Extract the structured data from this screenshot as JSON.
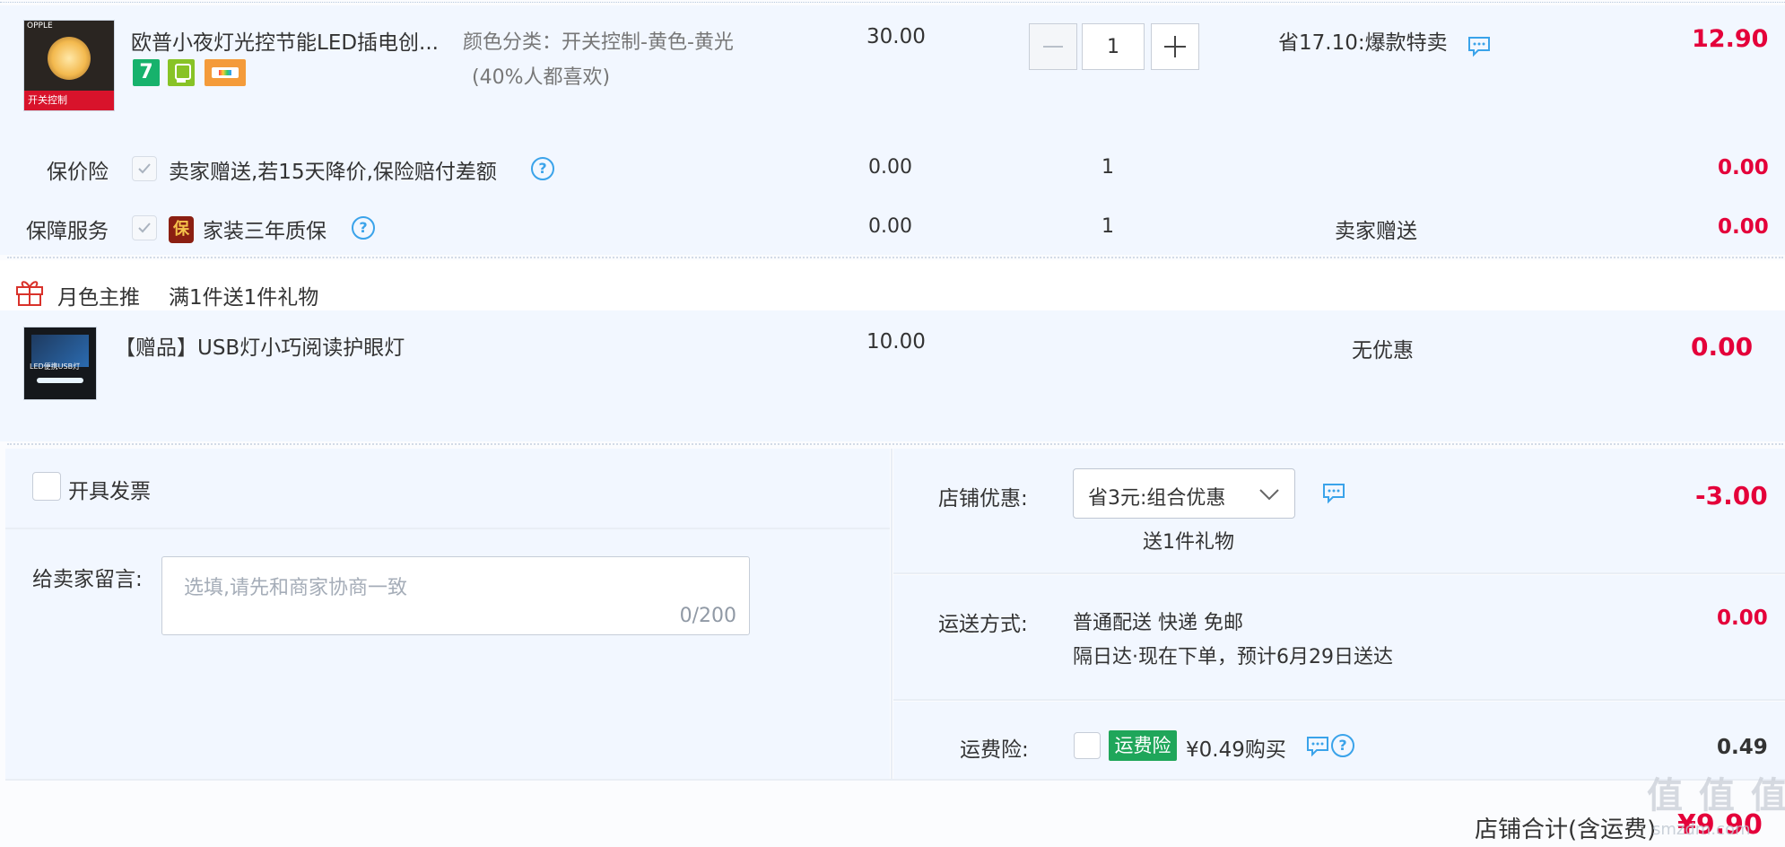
{
  "product": {
    "title": "欧普小夜灯光控节能LED插电创...",
    "sku_prefix": "颜色分类：",
    "sku_value": "开关控制-黄色-黄光",
    "popularity": "(40%人都喜欢)",
    "unit_price": "30.00",
    "quantity": "1",
    "promo": "省17.10:爆款特卖",
    "subtotal": "12.90",
    "tag1_text": "7",
    "thumb_brand": "OPPLE",
    "thumb_caption": "开关控制"
  },
  "services": [
    {
      "label": "保价险",
      "desc": "卖家赠送,若15天降价,保险赔付差额",
      "price": "0.00",
      "qty": "1",
      "promo": "",
      "subtotal": "0.00"
    },
    {
      "label": "保障服务",
      "badge": "保",
      "desc": "家装三年质保",
      "price": "0.00",
      "qty": "1",
      "promo": "卖家赠送",
      "subtotal": "0.00"
    }
  ],
  "gift_section": {
    "store_name": "月色主推",
    "rule": "满1件送1件礼物"
  },
  "gift_item": {
    "title": "【赠品】USB灯小巧阅读护眼灯",
    "price": "10.00",
    "promo": "无优惠",
    "subtotal": "0.00",
    "thumb_caption": "LED便携USB灯"
  },
  "invoice": {
    "label": "开具发票"
  },
  "message": {
    "label": "给卖家留言:",
    "placeholder": "选填,请先和商家协商一致",
    "counter": "0/200"
  },
  "store_discount": {
    "label": "店铺优惠:",
    "selected": "省3元:组合优惠",
    "note": "送1件礼物",
    "amount": "-3.00"
  },
  "shipping": {
    "label": "运送方式:",
    "method": "普通配送 快递 免邮",
    "eta": "隔日达·现在下单，预计6月29日送达",
    "amount": "0.00"
  },
  "freight_insurance": {
    "label": "运费险:",
    "badge": "运费险",
    "desc": "¥0.49购买",
    "amount": "0.49"
  },
  "total": {
    "label": "店铺合计(含运费)",
    "amount": "¥9.90"
  },
  "watermark": {
    "text": "值 值 值",
    "site": "smzdm.com"
  },
  "colors": {
    "accent_red": "#e4003a",
    "help_blue": "#3aa3ea",
    "badge_green": "#1fa65a"
  }
}
